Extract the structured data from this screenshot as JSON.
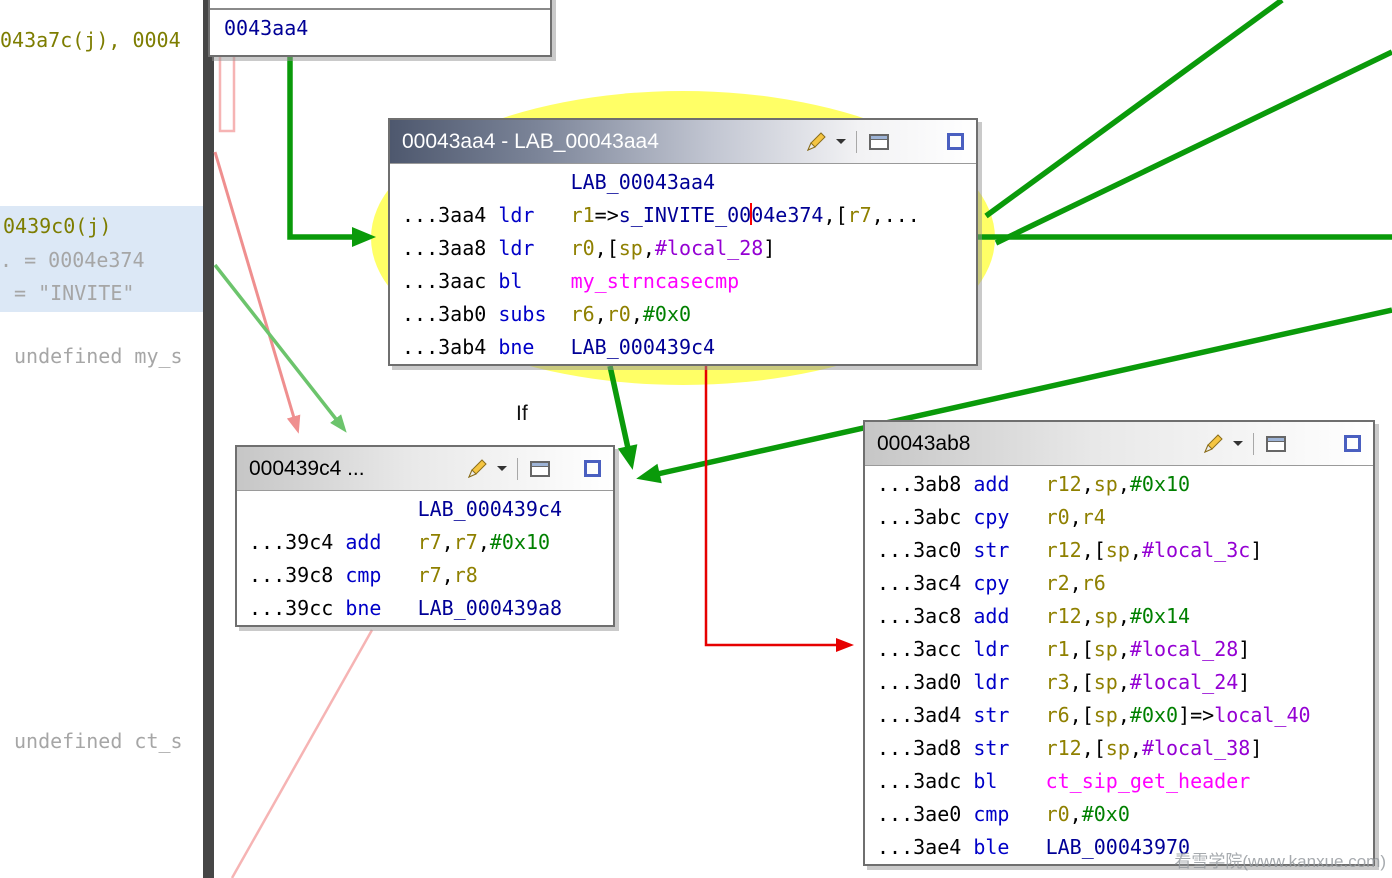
{
  "palette": {
    "addr": "#000000",
    "mnemonic": "#0000c8",
    "register": "#8f8000",
    "scalar": "#008000",
    "local": "#9400d3",
    "function": "#ff00ff",
    "label": "#000096",
    "edge_green": "#0a9a0a",
    "edge_pale_green": "#6cc46c",
    "edge_pink": "#ef8f8f",
    "edge_pink_light": "#f6b4b4",
    "edge_red": "#e60000",
    "highlight_yellow": "#ffff66",
    "listing_gray": "#a6a6a6",
    "listing_olive": "#7d7d00",
    "selection_blue": "#dce8f6",
    "cursor_red": "#ff0000"
  },
  "listing": {
    "lines": [
      {
        "text": "043a7c(j), 0004",
        "tone": "olive"
      },
      {
        "text": "0439c0(j)",
        "tone": "olive"
      },
      {
        "text": ". = 0004e374",
        "tone": "gray"
      },
      {
        "text": "= \"INVITE\"",
        "tone": "gray"
      },
      {
        "text": "undefined my_s",
        "tone": "gray"
      },
      {
        "text": "undefined ct_s",
        "tone": "gray"
      }
    ]
  },
  "blocks": {
    "partial_top": {
      "visible_text": "0043aa4"
    },
    "main": {
      "title": "00043aa4 - LAB_00043aa4",
      "label": "LAB_00043aa4",
      "rows": [
        [
          {
            "t": "...3aa4 ",
            "c": "addr"
          },
          {
            "t": "ldr   ",
            "c": "mn"
          },
          {
            "t": "r1",
            "c": "reg"
          },
          {
            "t": "=>",
            "c": "pl"
          },
          {
            "t": "s_INVITE_00",
            "c": "lab"
          },
          {
            "c": "cur"
          },
          {
            "t": "04e374",
            "c": "lab"
          },
          {
            "t": ",[",
            "c": "pl"
          },
          {
            "t": "r7",
            "c": "reg"
          },
          {
            "t": ",...",
            "c": "pl"
          }
        ],
        [
          {
            "t": "...3aa8 ",
            "c": "addr"
          },
          {
            "t": "ldr   ",
            "c": "mn"
          },
          {
            "t": "r0",
            "c": "reg"
          },
          {
            "t": ",[",
            "c": "pl"
          },
          {
            "t": "sp",
            "c": "reg"
          },
          {
            "t": ",",
            "c": "pl"
          },
          {
            "t": "#local_28",
            "c": "loc"
          },
          {
            "t": "]",
            "c": "pl"
          }
        ],
        [
          {
            "t": "...3aac ",
            "c": "addr"
          },
          {
            "t": "bl    ",
            "c": "mn"
          },
          {
            "t": "my_strncasecmp",
            "c": "fn"
          }
        ],
        [
          {
            "t": "...3ab0 ",
            "c": "addr"
          },
          {
            "t": "subs  ",
            "c": "mn"
          },
          {
            "t": "r6",
            "c": "reg"
          },
          {
            "t": ",",
            "c": "pl"
          },
          {
            "t": "r0",
            "c": "reg"
          },
          {
            "t": ",",
            "c": "pl"
          },
          {
            "t": "#0x0",
            "c": "num"
          }
        ],
        [
          {
            "t": "...3ab4 ",
            "c": "addr"
          },
          {
            "t": "bne   ",
            "c": "mn"
          },
          {
            "t": "LAB_000439c4",
            "c": "lab"
          }
        ]
      ]
    },
    "left": {
      "title": "000439c4 ...",
      "label": "LAB_000439c4",
      "rows": [
        [
          {
            "t": "...39c4 ",
            "c": "addr"
          },
          {
            "t": "add   ",
            "c": "mn"
          },
          {
            "t": "r7",
            "c": "reg"
          },
          {
            "t": ",",
            "c": "pl"
          },
          {
            "t": "r7",
            "c": "reg"
          },
          {
            "t": ",",
            "c": "pl"
          },
          {
            "t": "#0x10",
            "c": "num"
          }
        ],
        [
          {
            "t": "...39c8 ",
            "c": "addr"
          },
          {
            "t": "cmp   ",
            "c": "mn"
          },
          {
            "t": "r7",
            "c": "reg"
          },
          {
            "t": ",",
            "c": "pl"
          },
          {
            "t": "r8",
            "c": "reg"
          }
        ],
        [
          {
            "t": "...39cc ",
            "c": "addr"
          },
          {
            "t": "bne   ",
            "c": "mn"
          },
          {
            "t": "LAB_000439a8",
            "c": "lab"
          }
        ]
      ]
    },
    "right": {
      "title": "00043ab8",
      "rows": [
        [
          {
            "t": "...3ab8 ",
            "c": "addr"
          },
          {
            "t": "add   ",
            "c": "mn"
          },
          {
            "t": "r12",
            "c": "reg"
          },
          {
            "t": ",",
            "c": "pl"
          },
          {
            "t": "sp",
            "c": "reg"
          },
          {
            "t": ",",
            "c": "pl"
          },
          {
            "t": "#0x10",
            "c": "num"
          }
        ],
        [
          {
            "t": "...3abc ",
            "c": "addr"
          },
          {
            "t": "cpy   ",
            "c": "mn"
          },
          {
            "t": "r0",
            "c": "reg"
          },
          {
            "t": ",",
            "c": "pl"
          },
          {
            "t": "r4",
            "c": "reg"
          }
        ],
        [
          {
            "t": "...3ac0 ",
            "c": "addr"
          },
          {
            "t": "str   ",
            "c": "mn"
          },
          {
            "t": "r12",
            "c": "reg"
          },
          {
            "t": ",[",
            "c": "pl"
          },
          {
            "t": "sp",
            "c": "reg"
          },
          {
            "t": ",",
            "c": "pl"
          },
          {
            "t": "#local_3c",
            "c": "loc"
          },
          {
            "t": "]",
            "c": "pl"
          }
        ],
        [
          {
            "t": "...3ac4 ",
            "c": "addr"
          },
          {
            "t": "cpy   ",
            "c": "mn"
          },
          {
            "t": "r2",
            "c": "reg"
          },
          {
            "t": ",",
            "c": "pl"
          },
          {
            "t": "r6",
            "c": "reg"
          }
        ],
        [
          {
            "t": "...3ac8 ",
            "c": "addr"
          },
          {
            "t": "add   ",
            "c": "mn"
          },
          {
            "t": "r12",
            "c": "reg"
          },
          {
            "t": ",",
            "c": "pl"
          },
          {
            "t": "sp",
            "c": "reg"
          },
          {
            "t": ",",
            "c": "pl"
          },
          {
            "t": "#0x14",
            "c": "num"
          }
        ],
        [
          {
            "t": "...3acc ",
            "c": "addr"
          },
          {
            "t": "ldr   ",
            "c": "mn"
          },
          {
            "t": "r1",
            "c": "reg"
          },
          {
            "t": ",[",
            "c": "pl"
          },
          {
            "t": "sp",
            "c": "reg"
          },
          {
            "t": ",",
            "c": "pl"
          },
          {
            "t": "#local_28",
            "c": "loc"
          },
          {
            "t": "]",
            "c": "pl"
          }
        ],
        [
          {
            "t": "...3ad0 ",
            "c": "addr"
          },
          {
            "t": "ldr   ",
            "c": "mn"
          },
          {
            "t": "r3",
            "c": "reg"
          },
          {
            "t": ",[",
            "c": "pl"
          },
          {
            "t": "sp",
            "c": "reg"
          },
          {
            "t": ",",
            "c": "pl"
          },
          {
            "t": "#local_24",
            "c": "loc"
          },
          {
            "t": "]",
            "c": "pl"
          }
        ],
        [
          {
            "t": "...3ad4 ",
            "c": "addr"
          },
          {
            "t": "str   ",
            "c": "mn"
          },
          {
            "t": "r6",
            "c": "reg"
          },
          {
            "t": ",[",
            "c": "pl"
          },
          {
            "t": "sp",
            "c": "reg"
          },
          {
            "t": ",",
            "c": "pl"
          },
          {
            "t": "#0x0",
            "c": "num"
          },
          {
            "t": "]=>",
            "c": "pl"
          },
          {
            "t": "local_40",
            "c": "loc"
          }
        ],
        [
          {
            "t": "...3ad8 ",
            "c": "addr"
          },
          {
            "t": "str   ",
            "c": "mn"
          },
          {
            "t": "r12",
            "c": "reg"
          },
          {
            "t": ",[",
            "c": "pl"
          },
          {
            "t": "sp",
            "c": "reg"
          },
          {
            "t": ",",
            "c": "pl"
          },
          {
            "t": "#local_38",
            "c": "loc"
          },
          {
            "t": "]",
            "c": "pl"
          }
        ],
        [
          {
            "t": "...3adc ",
            "c": "addr"
          },
          {
            "t": "bl    ",
            "c": "mn"
          },
          {
            "t": "ct_sip_get_header",
            "c": "fn"
          }
        ],
        [
          {
            "t": "...3ae0 ",
            "c": "addr"
          },
          {
            "t": "cmp   ",
            "c": "mn"
          },
          {
            "t": "r0",
            "c": "reg"
          },
          {
            "t": ",",
            "c": "pl"
          },
          {
            "t": "#0x0",
            "c": "num"
          }
        ],
        [
          {
            "t": "...3ae4 ",
            "c": "addr"
          },
          {
            "t": "ble   ",
            "c": "mn"
          },
          {
            "t": "LAB_00043970",
            "c": "lab"
          }
        ]
      ]
    }
  },
  "edge_label": "If",
  "watermark": "看雪学院(www.kanxue.com)"
}
